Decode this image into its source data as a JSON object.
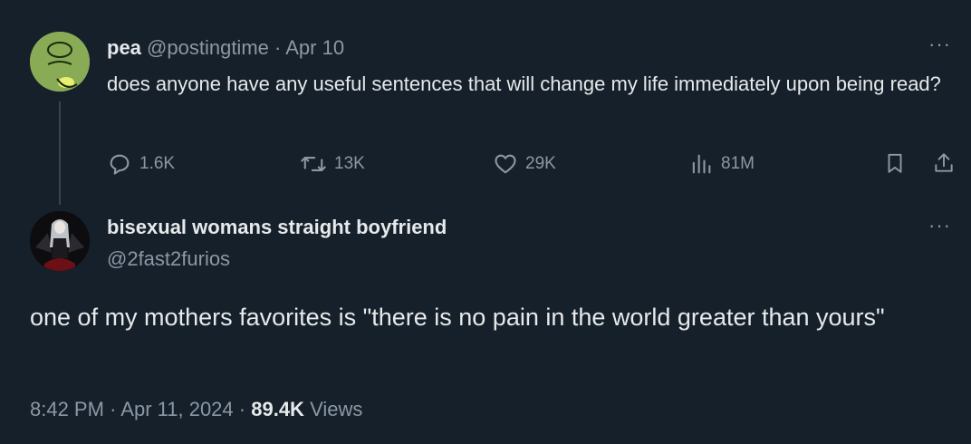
{
  "tweet": {
    "name": "pea",
    "handle": "@postingtime",
    "separator": "·",
    "date": "Apr 10",
    "more": "···",
    "text": "does anyone have any useful sentences that will change my life immediately upon being read?",
    "actions": {
      "replies": "1.6K",
      "retweets": "13K",
      "likes": "29K",
      "views": "81M"
    },
    "icons": [
      "reply-icon",
      "retweet-icon",
      "like-icon",
      "views-icon",
      "bookmark-icon",
      "share-icon"
    ]
  },
  "reply": {
    "name": "bisexual womans straight boyfriend",
    "handle": "@2fast2furios",
    "more": "···",
    "text": "one of my mothers favorites is \"there is no pain in the world greater than yours\"",
    "time": "8:42 PM",
    "separator": "·",
    "date": "Apr 11, 2024",
    "views_count": "89.4K",
    "views_label": "Views"
  },
  "colors": {
    "background": "#15202b",
    "text": "#e7e9ea",
    "muted": "#8b98a5",
    "avatar1": "#8aab55",
    "thread_line": "#38444d"
  }
}
